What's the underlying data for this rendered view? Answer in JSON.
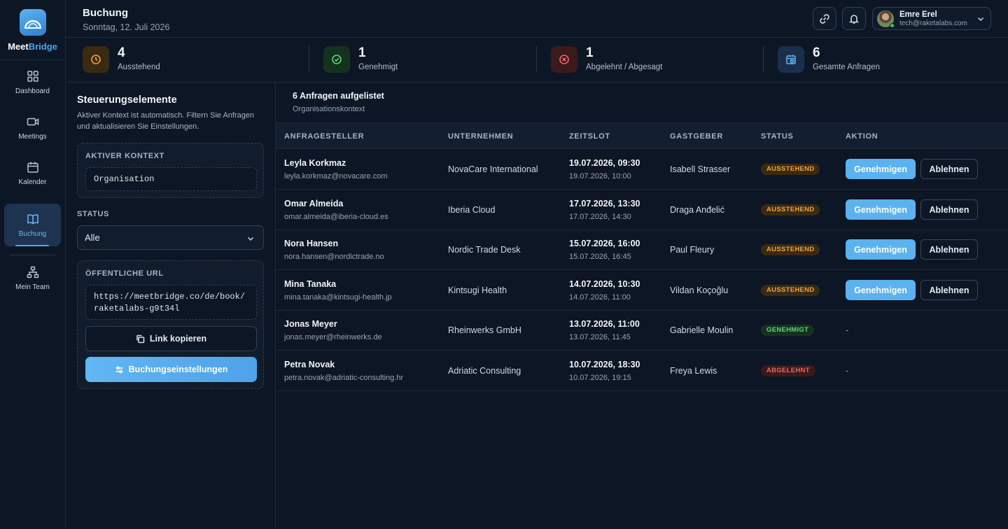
{
  "brand": {
    "name_part1": "Meet",
    "name_part2": "Bridge"
  },
  "nav": [
    {
      "label": "Dashboard",
      "icon": "grid-icon"
    },
    {
      "label": "Meetings",
      "icon": "video-icon"
    },
    {
      "label": "Kalender",
      "icon": "calendar-icon"
    },
    {
      "label": "Buchung",
      "icon": "book-icon",
      "active": true
    },
    {
      "label": "Mein Team",
      "icon": "org-chart-icon"
    }
  ],
  "header": {
    "title": "Buchung",
    "date": "Sonntag, 12. Juli 2026",
    "user": {
      "name": "Emre Erel",
      "email": "tech@raketalabs.com"
    }
  },
  "stats": [
    {
      "value": "4",
      "label": "Ausstehend",
      "icon": "clock-icon",
      "color": "#f0a43a"
    },
    {
      "value": "1",
      "label": "Genehmigt",
      "icon": "check-circle-icon",
      "color": "#5ed37e"
    },
    {
      "value": "1",
      "label": "Abgelehnt / Abgesagt",
      "icon": "x-circle-icon",
      "color": "#f06565"
    },
    {
      "value": "6",
      "label": "Gesamte Anfragen",
      "icon": "calendar-clock-icon",
      "color": "#5cb2ef"
    }
  ],
  "controls": {
    "title": "Steuerungselemente",
    "description": "Aktiver Kontext ist automatisch. Filtern Sie Anfragen und aktualisieren Sie Einstellungen.",
    "context_label": "AKTIVER KONTEXT",
    "context_value": "Organisation",
    "status_label": "STATUS",
    "status_value": "Alle",
    "url_label": "ÖFFENTLICHE URL",
    "url_line1": "https://meetbridge.co/de/book/",
    "url_line2": "raketalabs-g9t34l",
    "copy_label": "Link kopieren",
    "settings_label": "Buchungseinstellungen"
  },
  "list": {
    "count": "6 Anfragen aufgelistet",
    "context": "Organisationskontext",
    "columns": [
      "ANFRAGESTELLER",
      "UNTERNEHMEN",
      "ZEITSLOT",
      "GASTGEBER",
      "STATUS",
      "AKTION"
    ],
    "approve_label": "Genehmigen",
    "reject_label": "Ablehnen",
    "rows": [
      {
        "name": "Leyla Korkmaz",
        "email": "leyla.korkmaz@novacare.com",
        "company": "NovaCare International",
        "start": "19.07.2026, 09:30",
        "end": "19.07.2026, 10:00",
        "host": "Isabell Strasser",
        "status": "AUSSTEHEND",
        "status_type": "pending",
        "action": ""
      },
      {
        "name": "Omar Almeida",
        "email": "omar.almeida@iberia-cloud.es",
        "company": "Iberia Cloud",
        "start": "17.07.2026, 13:30",
        "end": "17.07.2026, 14:30",
        "host": "Draga Anđelić",
        "status": "AUSSTEHEND",
        "status_type": "pending",
        "action": ""
      },
      {
        "name": "Nora Hansen",
        "email": "nora.hansen@nordictrade.no",
        "company": "Nordic Trade Desk",
        "start": "15.07.2026, 16:00",
        "end": "15.07.2026, 16:45",
        "host": "Paul Fleury",
        "status": "AUSSTEHEND",
        "status_type": "pending",
        "action": ""
      },
      {
        "name": "Mina Tanaka",
        "email": "mina.tanaka@kintsugi-health.jp",
        "company": "Kintsugi Health",
        "start": "14.07.2026, 10:30",
        "end": "14.07.2026, 11:00",
        "host": "Vildan Koçoğlu",
        "status": "AUSSTEHEND",
        "status_type": "pending",
        "action": ""
      },
      {
        "name": "Jonas Meyer",
        "email": "jonas.meyer@rheinwerks.de",
        "company": "Rheinwerks GmbH",
        "start": "13.07.2026, 11:00",
        "end": "13.07.2026, 11:45",
        "host": "Gabrielle Moulin",
        "status": "GENEHMIGT",
        "status_type": "approved",
        "action": "-"
      },
      {
        "name": "Petra Novak",
        "email": "petra.novak@adriatic-consulting.hr",
        "company": "Adriatic Consulting",
        "start": "10.07.2026, 18:30",
        "end": "10.07.2026, 19:15",
        "host": "Freya Lewis",
        "status": "ABGELEHNT",
        "status_type": "rejected",
        "action": "-"
      }
    ]
  }
}
